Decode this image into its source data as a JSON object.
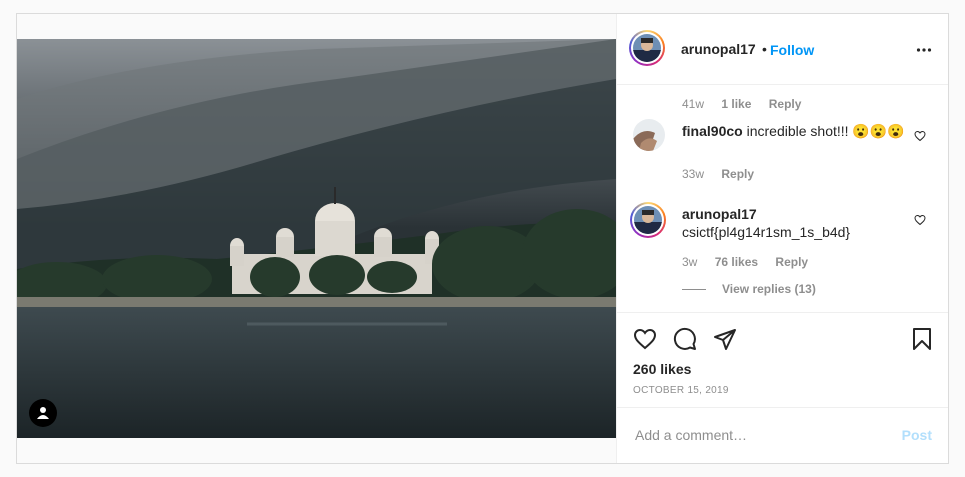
{
  "post": {
    "author": "arunopal17",
    "dot": "•",
    "follow_label": "Follow",
    "likes": "260 likes",
    "date": "OCTOBER 15, 2019",
    "comment_placeholder": "Add a comment…",
    "post_label": "Post"
  },
  "comments": [
    {
      "partial": true,
      "time": "41w",
      "likes": "1 like",
      "reply": "Reply"
    },
    {
      "username": "final90co",
      "text": "incredible shot!!! 😮😮😮",
      "time": "33w",
      "reply": "Reply"
    },
    {
      "username": "arunopal17",
      "text": "csictf{pl4g14r1sm_1s_b4d}",
      "time": "3w",
      "likes": "76 likes",
      "reply": "Reply",
      "view_replies": "View replies (13)"
    }
  ],
  "icons": [
    "user-tag-icon",
    "more-options-icon",
    "heart-icon",
    "comment-icon",
    "share-icon",
    "bookmark-icon"
  ],
  "colors": {
    "accent": "#0095f6",
    "post_disabled": "#b2dffc",
    "muted": "#8e8e8e",
    "border": "#dbdbdb"
  }
}
